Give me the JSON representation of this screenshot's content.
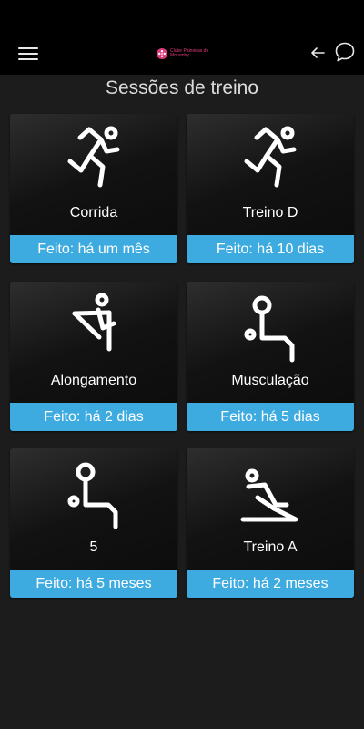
{
  "header": {
    "logo_text": "Clube Paineiras do Morumby",
    "menu_icon": "hamburger-menu-icon",
    "back_icon": "arrow-left-icon",
    "chat_icon": "chat-bubble-icon",
    "brand_color": "#e0397a"
  },
  "page": {
    "title": "Sessões de treino"
  },
  "sessions": [
    {
      "name": "Corrida",
      "status": "Feito: há um mês",
      "icon": "running-icon"
    },
    {
      "name": "Treino D",
      "status": "Feito: há 10 dias",
      "icon": "running-icon"
    },
    {
      "name": "Alongamento",
      "status": "Feito: há 2 dias",
      "icon": "stretching-icon"
    },
    {
      "name": "Musculação",
      "status": "Feito: há 5 dias",
      "icon": "bodybuilding-icon"
    },
    {
      "name": "5",
      "status": "Feito: há 5 meses",
      "icon": "bodybuilding-icon"
    },
    {
      "name": "Treino A",
      "status": "Feito: há 2 meses",
      "icon": "abdominal-icon"
    }
  ],
  "colors": {
    "status_bar": "#3dabe0",
    "background": "#1c1c1c"
  }
}
